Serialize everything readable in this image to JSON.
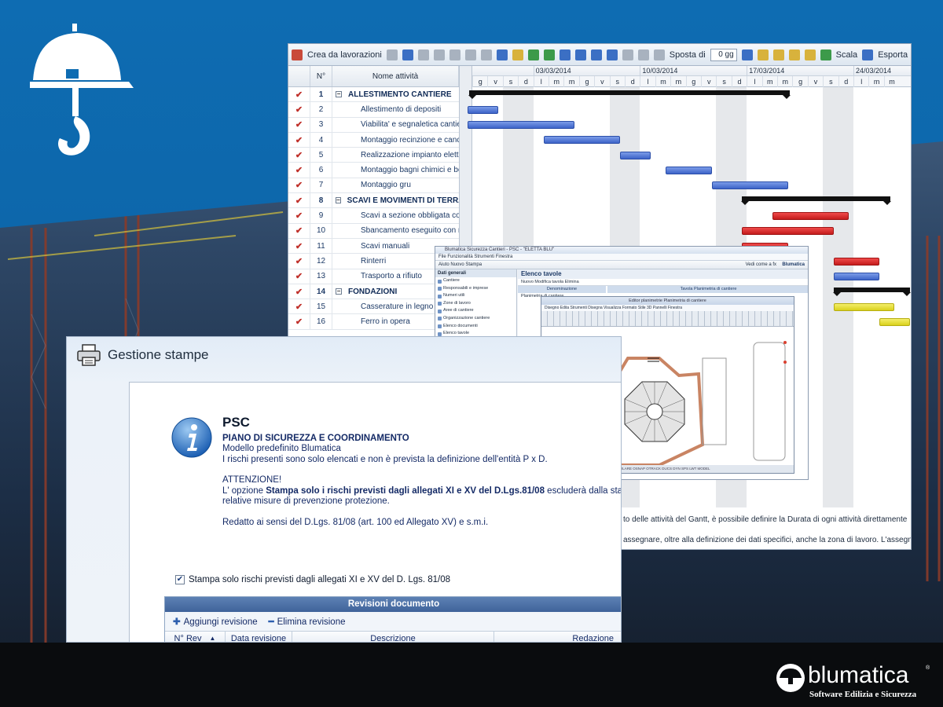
{
  "gantt": {
    "toolbar": {
      "create_label": "Crea da lavorazioni",
      "shift_label": "Sposta di",
      "shift_value": "0 gg",
      "scale_label": "Scala",
      "export_label": "Esporta"
    },
    "columns": {
      "no": "N°",
      "name": "Nome attività"
    },
    "weeks": [
      "03/03/2014",
      "10/03/2014",
      "17/03/2014",
      "24/03/2014"
    ],
    "days": [
      "g",
      "v",
      "s",
      "d",
      "l",
      "m",
      "m",
      "g",
      "v",
      "s",
      "d",
      "l",
      "m",
      "m",
      "g",
      "v",
      "s",
      "d",
      "l",
      "m",
      "m",
      "g",
      "v",
      "s",
      "d",
      "l",
      "m",
      "m"
    ],
    "rows": [
      {
        "no": "1",
        "name": "ALLESTIMENTO CANTIERE",
        "summary": true
      },
      {
        "no": "2",
        "name": "Allestimento di depositi"
      },
      {
        "no": "3",
        "name": "Viabilita' e segnaletica cantiere"
      },
      {
        "no": "4",
        "name": "Montaggio recinzione e cancel"
      },
      {
        "no": "5",
        "name": "Realizzazione impianto elettric"
      },
      {
        "no": "6",
        "name": "Montaggio bagni chimici e box"
      },
      {
        "no": "7",
        "name": "Montaggio gru"
      },
      {
        "no": "8",
        "name": "SCAVI E MOVIMENTI DI TERRA",
        "summary": true
      },
      {
        "no": "9",
        "name": "Scavi a sezione obbligata con"
      },
      {
        "no": "10",
        "name": "Sbancamento eseguito con me"
      },
      {
        "no": "11",
        "name": "Scavi manuali"
      },
      {
        "no": "12",
        "name": "Rinterri"
      },
      {
        "no": "13",
        "name": "Trasporto a rifiuto"
      },
      {
        "no": "14",
        "name": "FONDAZIONI",
        "summary": true
      },
      {
        "no": "15",
        "name": "Casserature in legno"
      },
      {
        "no": "16",
        "name": "Ferro in opera"
      }
    ],
    "doc_lines": [
      "to delle attività del Gantt, è  possibile definire  la Durata di ogni attività direttamente",
      "assegnare, oltre alla definizione dei dati specifici, anche la zona di lavoro. L'assegnaz"
    ]
  },
  "sicurezza": {
    "title": "Blumatica Sicurezza Cantieri - PSC - \"ELETTA BLU\"",
    "menu": "File   Funzionalità   Strumenti   Finestra",
    "toolbar": "Aiuto    Nuovo   Stampa",
    "right_tool": "Vedi come a fx",
    "left_head": "Dati generali",
    "left_items": [
      "Cantiere",
      "Responsabili e imprese",
      "Numeri utili",
      "Zone di lavoro",
      "Aree di cantiere",
      "Organizzazione cantiere",
      "Elenco documenti",
      "Elenco tavole"
    ],
    "main_title": "Elenco tavole",
    "main_toolbar": "Nuovo   Modifica tavola   Elimina",
    "col_denom": "Denominazione",
    "col_tavola": "Tavola Planimetria di cantiere",
    "first_row": "Planimetria di cantiere",
    "brand": "Blumatica"
  },
  "cad": {
    "title": "Editor planimetrie Planimetria di cantiere",
    "menu": "Disegno  Edita  Strumenti  Disegna  Visualizza  Formato  Stile 3D  Pannelli  Finestra",
    "status": "SNAP  GRIGLIA  ORTO  POLARE  OSNAP  OTRACK  DUCS  DYN  SPS  LWT  MODEL"
  },
  "stampe": {
    "title": "Gestione stampe",
    "psc_title": "PSC",
    "psc_subtitle": "PIANO DI SICUREZZA E COORDINAMENTO",
    "line1": "Modello predefinito Blumatica",
    "line2": "I rischi presenti sono solo elencati e non è prevista la definizione dell'entità P x D.",
    "attention": "ATTENZIONE!",
    "opt_pre": "L' opzione ",
    "opt_bold": "Stampa solo i rischi previsti dagli allegati XI e XV del D.Lgs.81/08",
    "opt_post": " escluderà dalla stampa",
    "line_measures": "relative misure di prevenzione protezione.",
    "line_law": "Redatto ai sensi del D.Lgs. 81/08 (art. 100 ed Allegato XV) e s.m.i.",
    "checkbox_label": "Stampa solo rischi previsti  dagli allegati XI e XV del D. Lgs. 81/08",
    "checkbox_checked": true,
    "revisions_title": "Revisioni documento",
    "add_revision": "Aggiungi revisione",
    "delete_revision": "Elimina revisione",
    "col_rev": "N° Rev",
    "col_date": "Data revisione",
    "col_desc": "Descrizione",
    "col_red": "Redazione"
  },
  "brand": {
    "name": "blumatica",
    "reg": "®",
    "tagline": "Software Edilizia e Sicurezza"
  }
}
